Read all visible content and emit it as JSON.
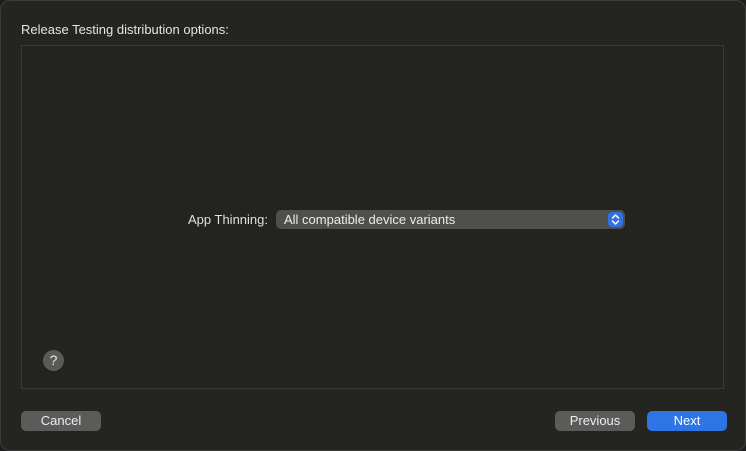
{
  "sheet": {
    "title": "Release Testing distribution options:"
  },
  "options": {
    "app_thinning": {
      "label": "App Thinning:",
      "selected": "All compatible device variants"
    }
  },
  "help": {
    "glyph": "?"
  },
  "buttons": {
    "cancel": "Cancel",
    "previous": "Previous",
    "next": "Next"
  },
  "colors": {
    "accent": "#2d74e4",
    "background": "#242421"
  }
}
